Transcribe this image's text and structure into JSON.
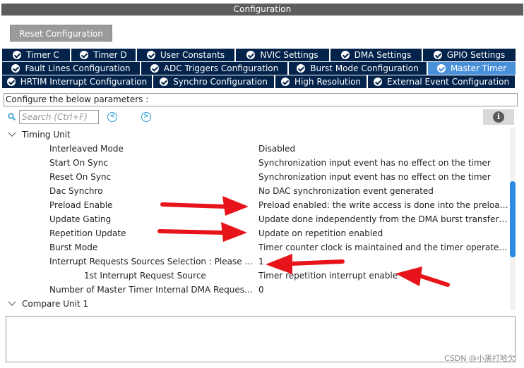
{
  "window": {
    "title": "Configuration"
  },
  "toolbar": {
    "reset_label": "Reset Configuration"
  },
  "tabs": {
    "row1": [
      {
        "label": "Timer C",
        "active": false
      },
      {
        "label": "Timer D",
        "active": false
      },
      {
        "label": "User Constants",
        "active": false
      },
      {
        "label": "NVIC Settings",
        "active": false
      },
      {
        "label": "DMA Settings",
        "active": false
      },
      {
        "label": "GPIO Settings",
        "active": false
      }
    ],
    "row2": [
      {
        "label": "Fault Lines Configuration",
        "active": false
      },
      {
        "label": "ADC Triggers Configuration",
        "active": false
      },
      {
        "label": "Burst Mode Configuration",
        "active": false
      },
      {
        "label": "Master Timer",
        "active": true
      }
    ],
    "row3": [
      {
        "label": "HRTIM Interrupt Configuration",
        "active": false
      },
      {
        "label": "Synchro Configuration",
        "active": false
      },
      {
        "label": "High Resolution",
        "active": false
      },
      {
        "label": "External Event Configuration",
        "active": false
      }
    ]
  },
  "configure": {
    "label": "Configure the below parameters :"
  },
  "search": {
    "placeholder": "Search (Ctrl+F)",
    "prev_icon": "chevron-left-icon",
    "next_icon": "chevron-right-icon",
    "info_icon": "info-icon"
  },
  "groups": {
    "timing_unit": "Timing Unit",
    "compare_unit": "Compare Unit 1"
  },
  "params": [
    {
      "name": "Interleaved Mode",
      "value": "Disabled"
    },
    {
      "name": "Start On Sync",
      "value": "Synchronization input event has no effect on the timer"
    },
    {
      "name": "Reset On Sync",
      "value": "Synchronization input event has no effect on the timer"
    },
    {
      "name": "Dac Synchro",
      "value": "No DAC synchronization event generated"
    },
    {
      "name": "Preload Enable",
      "value": "Preload enabled: the write access is done into the preload register"
    },
    {
      "name": "Update Gating",
      "value": "Update done independently from the DMA burst transfer completion"
    },
    {
      "name": "Repetition Update",
      "value": "Update on repetition enabled"
    },
    {
      "name": "Burst Mode",
      "value": "Timer counter clock is maintained and the timer operates normally"
    },
    {
      "name": "Interrupt Requests Sources Selection : Please enter the number of sources",
      "value": "1"
    },
    {
      "name": "1st Interrupt Request Source",
      "value": "Timer repetition interrupt enable"
    },
    {
      "name": "Number of Master Timer Internal DMA Request Sources",
      "value": "0"
    }
  ],
  "colors": {
    "tab_bg": "#03234b",
    "tab_active": "#4a90d9",
    "accent": "#2a9fd6",
    "arrow": "#e8141b"
  },
  "watermark": "CSDN @小黑打哈欠"
}
